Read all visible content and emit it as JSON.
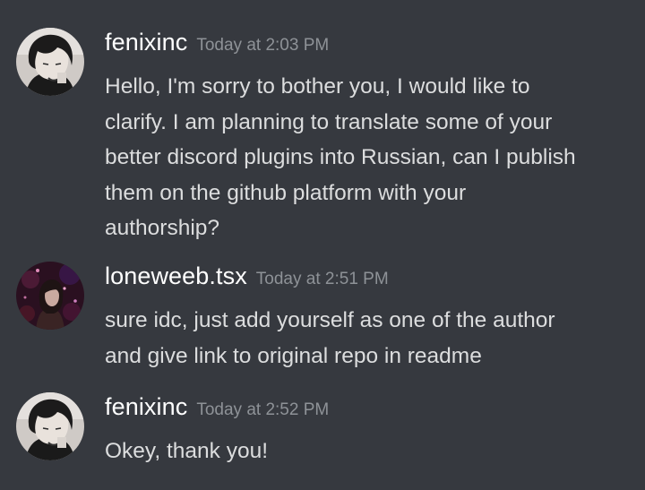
{
  "messages": [
    {
      "author": "fenixinc",
      "timestamp": "Today at 2:03 PM",
      "avatar": "fenixinc-avatar",
      "content": "Hello, I'm sorry to bother you, I would like to\nclarify. I am planning to translate some of your\nbetter discord plugins into Russian, can I publish\nthem on the github platform with your\nauthorship?"
    },
    {
      "author": "loneweeb.tsx",
      "timestamp": "Today at 2:51 PM",
      "avatar": "loneweeb-avatar",
      "content": "sure idc, just add yourself as one of the author\nand give link to original repo in readme"
    },
    {
      "author": "fenixinc",
      "timestamp": "Today at 2:52 PM",
      "avatar": "fenixinc-avatar",
      "content": "Okey, thank you!"
    }
  ],
  "colors": {
    "background": "#36393f",
    "username": "#ffffff",
    "timestamp": "#8e9297",
    "text": "#dcddde"
  }
}
